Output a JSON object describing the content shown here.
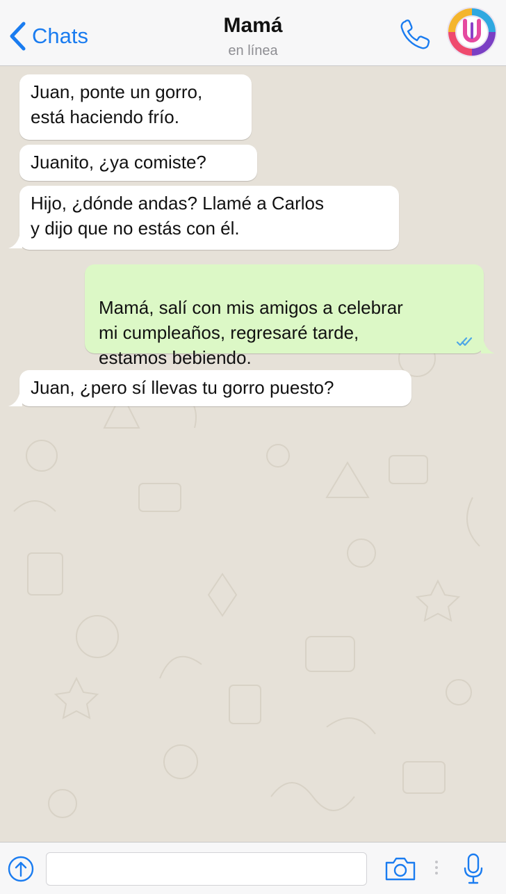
{
  "header": {
    "back_label": "Chats",
    "contact_name": "Mamá",
    "status": "en línea"
  },
  "messages": [
    {
      "direction": "incoming",
      "text": "Juan, ponte un gorro,\nestá haciendo frío."
    },
    {
      "direction": "incoming",
      "text": "Juanito, ¿ya comiste?"
    },
    {
      "direction": "incoming",
      "text": "Hijo, ¿dónde andas? Llamé a Carlos\ny dijo que no estás con él."
    },
    {
      "direction": "outgoing",
      "text": "Mamá, salí con mis amigos a celebrar\nmi cumpleaños, regresaré tarde,\nestamos bebiendo.",
      "status": "read"
    },
    {
      "direction": "incoming",
      "text": "Juan, ¿pero sí llevas tu gorro puesto?"
    }
  ],
  "composer": {
    "value": "",
    "placeholder": ""
  },
  "icons": {
    "back": "chevron-left-icon",
    "call": "phone-icon",
    "avatar": "profile-logo",
    "share": "share-icon",
    "camera": "camera-icon",
    "mic": "microphone-icon",
    "read": "double-check-icon"
  },
  "colors": {
    "accent": "#1a7cf0",
    "incoming_bubble": "#ffffff",
    "outgoing_bubble": "#dcf8c6",
    "read_check": "#4fa7e6",
    "background": "#e6e1d8"
  }
}
